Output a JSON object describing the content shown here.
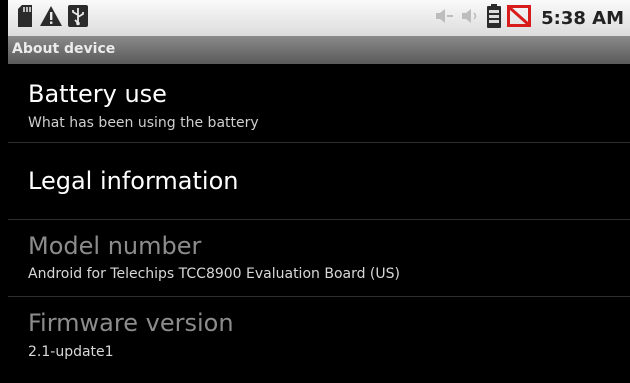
{
  "status_bar": {
    "time": "5:38 AM",
    "left_icons": [
      "sd-card-icon",
      "warning-icon",
      "usb-icon"
    ],
    "right_icons": [
      "volume-low-icon",
      "volume-icon",
      "battery-icon",
      "no-signal-icon"
    ]
  },
  "title_bar": {
    "title": "About device"
  },
  "items": [
    {
      "label": "Battery use",
      "summary": "What has been using the battery"
    },
    {
      "label": "Legal information",
      "summary": ""
    },
    {
      "label": "Model number",
      "summary": "Android for Telechips TCC8900 Evaluation Board (US)"
    },
    {
      "label": "Firmware version",
      "summary": "2.1-update1"
    }
  ],
  "colors": {
    "background": "#000000",
    "status_bar": "#e8e8e8",
    "title_bar": "#737373",
    "enabled_text": "#ffffff",
    "disabled_text": "#8c8c8c",
    "no_signal_red": "#d81b1b"
  }
}
